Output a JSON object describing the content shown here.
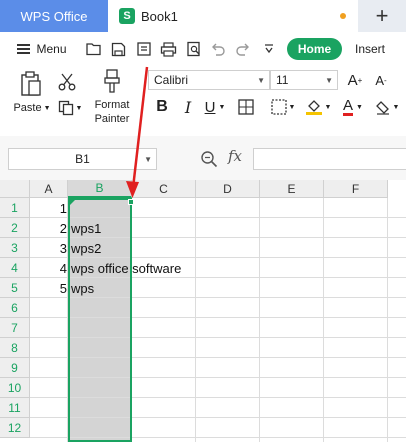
{
  "tabs": {
    "app_tab": "WPS Office",
    "doc_tab": "Book1",
    "doc_icon_letter": "S",
    "new_tab_symbol": "+"
  },
  "toolbar": {
    "menu_label": "Menu",
    "quick_access_icons": [
      "open-icon",
      "save-icon",
      "export-icon",
      "print-icon",
      "print-preview-icon",
      "undo-icon",
      "redo-icon",
      "more-icon"
    ],
    "home_tab": "Home",
    "insert_tab": "Insert"
  },
  "ribbon": {
    "paste_label": "Paste",
    "format_painter_label_1": "Format",
    "format_painter_label_2": "Painter",
    "font_name": "Calibri",
    "font_size": "11",
    "bold": "B",
    "italic": "I",
    "underline": "U",
    "font_color_glyph": "A"
  },
  "formula_bar": {
    "name_box": "B1",
    "fx_label": "fx",
    "formula_value": ""
  },
  "grid": {
    "columns": [
      "A",
      "B",
      "C",
      "D",
      "E",
      "F"
    ],
    "selected_column": "B",
    "rows": [
      "1",
      "2",
      "3",
      "4",
      "5",
      "6",
      "7",
      "8",
      "9",
      "10",
      "11",
      "12"
    ],
    "col_a_values": [
      "1",
      "2",
      "3",
      "4",
      "5"
    ],
    "col_b_values": [
      "",
      "wps1",
      "wps2",
      "wps office software",
      "wps"
    ]
  },
  "colors": {
    "accent": "#1aa361",
    "app_tab_bg": "#5b8de8",
    "annotation_arrow": "#e02020"
  }
}
